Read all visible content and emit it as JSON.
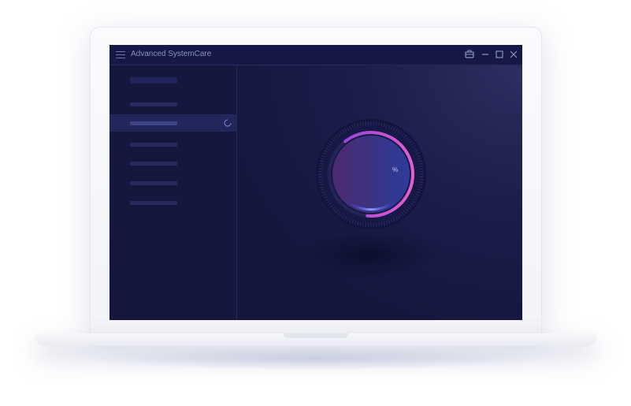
{
  "window": {
    "title": "Advanced SystemCare"
  },
  "gauge": {
    "percent_symbol": "%",
    "progress": 0.62,
    "colors": {
      "arc_start": "#8d3fd8",
      "arc_end": "#e25fd0",
      "base_glow": "#5a6cff",
      "knob_left": "#4b2a6e",
      "knob_right": "#2c3c9a"
    }
  },
  "sidebar": {
    "active_index": 2
  },
  "icons": {
    "menu": "hamburger-menu-icon",
    "toolbox": "toolbox-icon",
    "minimize": "minimize-icon",
    "maximize": "maximize-icon",
    "close": "close-icon",
    "spinner": "loading-spinner-icon"
  },
  "colors": {
    "screen_bg": "#141440",
    "accent": "#e25fd0",
    "titlebar_text": "#8a8fc4"
  }
}
